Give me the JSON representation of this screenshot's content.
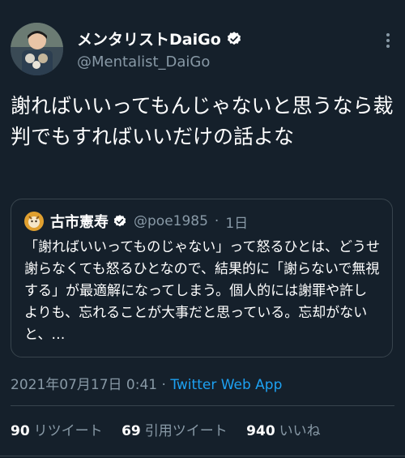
{
  "tweet": {
    "author_name": "メンタリストDaiGo",
    "author_handle": "@Mentalist_DaiGo",
    "text": "謝ればいいってもんじゃないと思うなら裁判でもすればいいだけの話よな",
    "timestamp": "2021年07月17日 0:41",
    "separator": "·",
    "source": "Twitter Web App"
  },
  "quote": {
    "author_name": "古市憲寿",
    "author_handle": "@poe1985",
    "separator": "·",
    "age": "1日",
    "text": "「謝ればいいってものじゃない」って怒るひとは、どうせ謝らなくても怒るひとなので、結果的に「謝らないで無視する」が最適解になってしまう。個人的には謝罪や許しよりも、忘れることが大事だと思っている。忘却がないと、…"
  },
  "stats": {
    "retweets_count": "90",
    "retweets_label": "リツイート",
    "quotes_count": "69",
    "quotes_label": "引用ツイート",
    "likes_count": "940",
    "likes_label": "いいね"
  },
  "colors": {
    "background": "#15202b",
    "secondary_text": "#8899a6",
    "accent": "#1da1f2",
    "border": "#38444d"
  },
  "icons": {
    "verified": "verified-badge-icon",
    "more": "more-options-icon"
  }
}
